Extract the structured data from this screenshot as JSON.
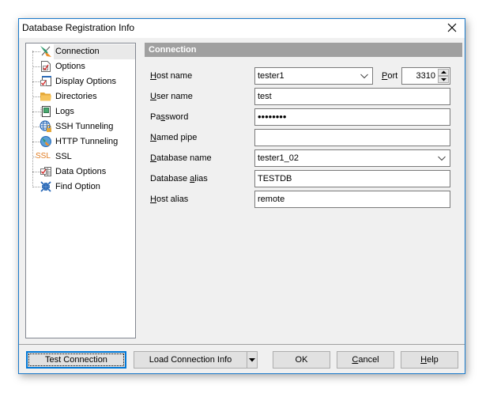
{
  "window": {
    "title": "Database Registration Info",
    "close_icon": "close-icon"
  },
  "tree": {
    "items": [
      {
        "label": "Connection",
        "icon": "plug-icon",
        "selected": true
      },
      {
        "label": "Options",
        "icon": "options-icon"
      },
      {
        "label": "Display Options",
        "icon": "display-options-icon"
      },
      {
        "label": "Directories",
        "icon": "folder-icon"
      },
      {
        "label": "Logs",
        "icon": "log-icon"
      },
      {
        "label": "SSH Tunneling",
        "icon": "ssh-globe-lock-icon"
      },
      {
        "label": "HTTP Tunneling",
        "icon": "http-tunnel-icon"
      },
      {
        "label": "SSL",
        "icon": "ssl-icon",
        "icon_text": "SSL"
      },
      {
        "label": "Data Options",
        "icon": "data-options-icon"
      },
      {
        "label": "Find Option",
        "icon": "find-option-icon"
      }
    ]
  },
  "section": {
    "title": "Connection"
  },
  "form": {
    "host_name": {
      "label_u": "H",
      "label_rest": "ost name",
      "value": "tester1"
    },
    "port": {
      "label_u": "P",
      "label_rest": "ort",
      "value": "3310"
    },
    "user_name": {
      "label_u": "U",
      "label_rest": "ser name",
      "value": "test"
    },
    "password": {
      "label_pre": "Pa",
      "label_u": "s",
      "label_rest": "sword",
      "value": "••••••••"
    },
    "named_pipe": {
      "label_u": "N",
      "label_rest": "amed pipe",
      "value": ""
    },
    "database_name": {
      "label_u": "D",
      "label_rest": "atabase name",
      "value": "tester1_02"
    },
    "database_alias": {
      "label_pre": "Database ",
      "label_u": "a",
      "label_rest": "lias",
      "value": "TESTDB"
    },
    "host_alias": {
      "label_u": "H",
      "label_rest": "ost alias",
      "value": "remote"
    }
  },
  "buttons": {
    "test_connection": "Test Connection",
    "load_connection_info": "Load Connection Info",
    "ok": "OK",
    "cancel_u": "C",
    "cancel_rest": "ancel",
    "help_u": "H",
    "help_rest": "elp"
  },
  "colors": {
    "accent": "#0078d7",
    "section_header": "#a0a0a0",
    "window_border": "#1979ca"
  }
}
